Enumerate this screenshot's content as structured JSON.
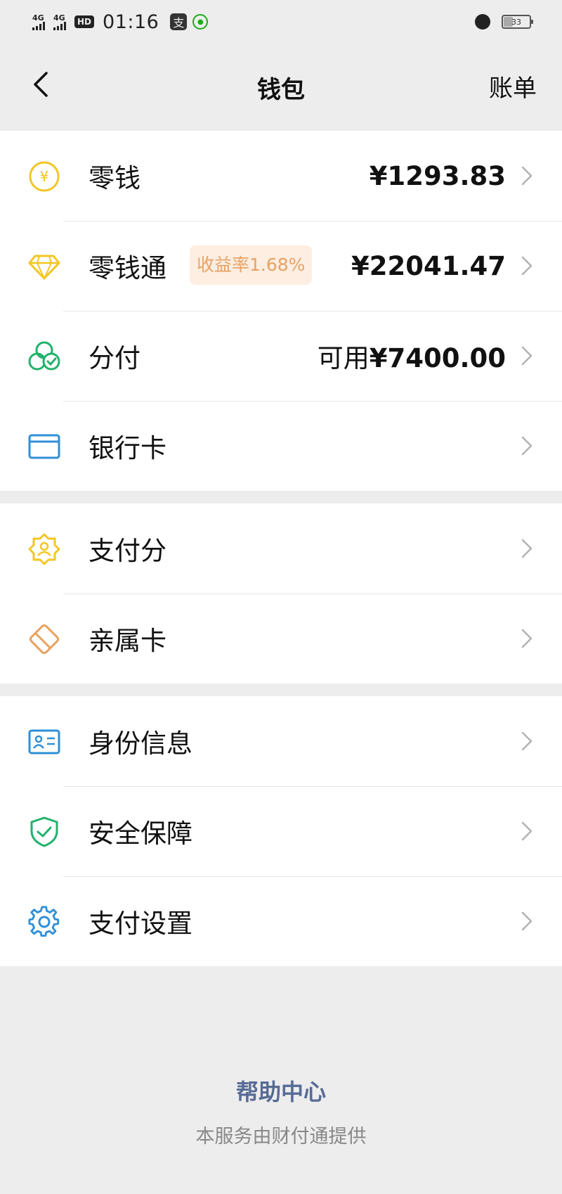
{
  "status_bar": {
    "network_1": "4G",
    "network_2": "4G",
    "hd": "HD",
    "time": "01:16",
    "app_glyph": "支",
    "battery": "33"
  },
  "nav": {
    "title": "钱包",
    "right_label": "账单",
    "back_icon": "chevron-left-icon"
  },
  "groups": [
    {
      "items": [
        {
          "icon": "yuan-coin-icon",
          "label": "零钱",
          "value": "¥1293.83"
        },
        {
          "icon": "diamond-icon",
          "label": "零钱通",
          "badge": "收益率1.68%",
          "value": "¥22041.47"
        },
        {
          "icon": "clover-check-icon",
          "label": "分付",
          "value_prefix": "可用",
          "value": "¥7400.00"
        },
        {
          "icon": "bank-card-icon",
          "label": "银行卡"
        }
      ]
    },
    {
      "items": [
        {
          "icon": "badge-person-icon",
          "label": "支付分"
        },
        {
          "icon": "family-card-icon",
          "label": "亲属卡"
        }
      ]
    },
    {
      "items": [
        {
          "icon": "id-card-icon",
          "label": "身份信息"
        },
        {
          "icon": "shield-check-icon",
          "label": "安全保障"
        },
        {
          "icon": "gear-icon",
          "label": "支付设置"
        }
      ]
    }
  ],
  "colors": {
    "yellow": "#f3c623",
    "green": "#21b26b",
    "blue": "#2f8fd6",
    "orange": "#e8a15f",
    "link": "#576b95"
  },
  "footer": {
    "help_link": "帮助中心",
    "note": "本服务由财付通提供"
  }
}
